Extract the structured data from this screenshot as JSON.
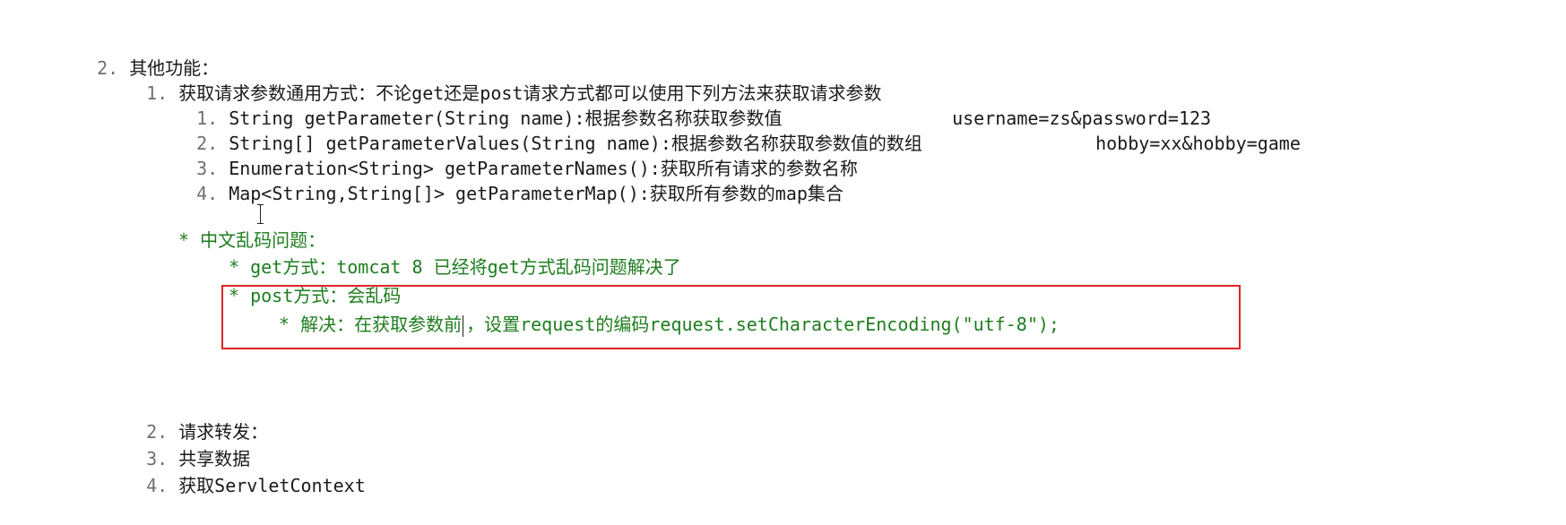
{
  "section": {
    "num": "2.",
    "title": "其他功能："
  },
  "sub1": {
    "num": "1.",
    "title": "获取请求参数通用方式：不论get还是post请求方式都可以使用下列方法来获取请求参数",
    "methods": [
      {
        "num": "1.",
        "text": "String getParameter(String name):根据参数名称获取参数值",
        "example": "username=zs&password=123"
      },
      {
        "num": "2.",
        "text": "String[] getParameterValues(String name):根据参数名称获取参数值的数组",
        "example": "hobby=xx&hobby=game"
      },
      {
        "num": "3.",
        "text": "Enumeration<String> getParameterNames():获取所有请求的参数名称",
        "example": ""
      },
      {
        "num": "4.",
        "text": "Map<String,String[]> getParameterMap():获取所有参数的map集合",
        "example": ""
      }
    ]
  },
  "notes": {
    "heading": "* 中文乱码问题：",
    "get": "* get方式：tomcat 8 已经将get方式乱码问题解决了",
    "post": "* post方式：会乱码",
    "solve_a": "* 解决：在获取参数前",
    "solve_b": "，设置request的编码request.setCharacterEncoding(\"utf-8\");"
  },
  "more": [
    {
      "num": "2.",
      "text": "请求转发："
    },
    {
      "num": "3.",
      "text": "共享数据"
    },
    {
      "num": "4.",
      "text": "获取ServletContext"
    }
  ],
  "colors": {
    "comment_green": "#1e7d1e",
    "highlight_red": "#e02424",
    "number_gray": "#6f6f6f"
  }
}
